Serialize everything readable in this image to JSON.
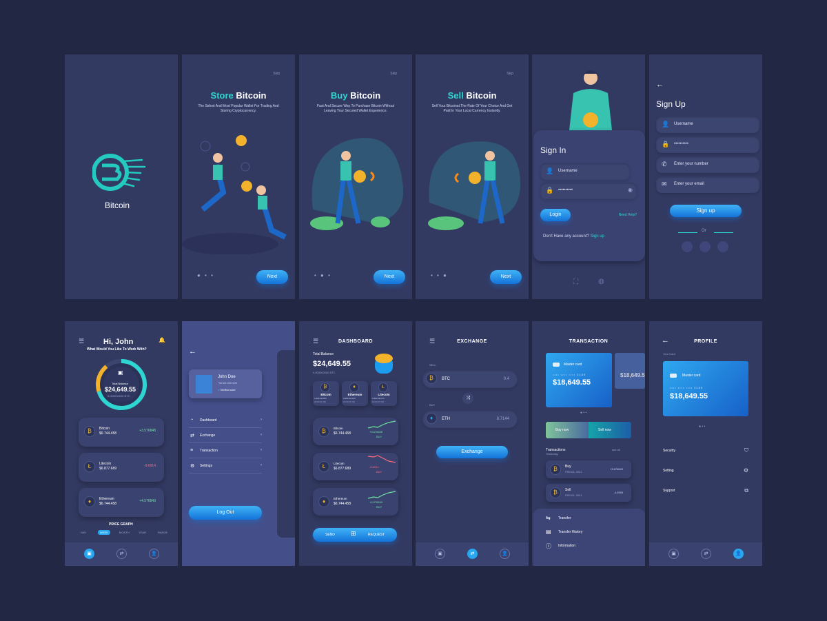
{
  "splash": {
    "title": "Bitcoin"
  },
  "onboarding": [
    {
      "skip": "Skip",
      "word": "Store",
      "coin": "Bitcoin",
      "desc": "The Safest And Most Popular Wallet For Trading And Storing Cryptocurrency.",
      "next": "Next"
    },
    {
      "skip": "Skip",
      "word": "Buy",
      "coin": "Bitcoin",
      "desc": "Fast And Secure Way To Purchase Bitcoin Without Leaving Your Secured Wallet Experience.",
      "next": "Next"
    },
    {
      "skip": "Skip",
      "word": "Sell",
      "coin": "Bitcoin",
      "desc": "Sell Your Bitcoinat The Rate Of Your Choice And Get Paid In Your Local Currency Instantly.",
      "next": "Next"
    }
  ],
  "signin": {
    "title": "Sign In",
    "username": "Username",
    "password": "••••••••••",
    "login": "Login",
    "help": "Need Help?",
    "no_account": "Don't Have any account?",
    "signup_link": "Sign up"
  },
  "signup": {
    "back": "←",
    "title": "Sign Up",
    "username": "Username",
    "password": "••••••••••",
    "phone": "Enter your number",
    "email": "Enter your email",
    "button": "Sign up",
    "or": "Or"
  },
  "home": {
    "greeting": "Hi, John",
    "question": "What Would You Like To Work With?",
    "total_label": "Total Balance",
    "total": "$24,649.55",
    "btc": "0.000000000 BTC",
    "coins": [
      {
        "name": "Bitcoin",
        "amount": "$6.744.458",
        "change": "+3.576848"
      },
      {
        "name": "Litecoin",
        "amount": "$6.877.689",
        "change": "-9.6914"
      },
      {
        "name": "Ethereum",
        "amount": "$6.744.458",
        "change": "+4.576849"
      }
    ],
    "graph_title": "PRICE GRAPH",
    "ranges": [
      "DAY",
      "WEEK",
      "MONTH",
      "YEAR",
      "RANGE"
    ]
  },
  "sidemenu": {
    "back": "←",
    "name": "John Doe",
    "phone": "+00 00 000 000",
    "verified": "Verified user",
    "items": [
      "Dashboard",
      "Exchange",
      "Transaction",
      "Settings"
    ],
    "logout": "Log Out"
  },
  "dashboard": {
    "title": "DASHBOARD",
    "total_label": "Total Balance",
    "total": "$24,649.55",
    "btc": "0.000000000 BTC",
    "minis": [
      {
        "name": "Bitcoin",
        "v1": "0.0000 000 BTC",
        "v2": "00,000.00 USD"
      },
      {
        "name": "Ethereum",
        "v1": "0.0000 000 ETH",
        "v2": "00,000.00 USD"
      },
      {
        "name": "Litecoin",
        "v1": "0.0000 000 LTC",
        "v2": "00,000.00 USD"
      }
    ],
    "rows": [
      {
        "name": "Bitcoin",
        "amount": "$6.744.458",
        "change": "+3.576848",
        "act": "BUY"
      },
      {
        "name": "Litecoin",
        "amount": "$6.877.689",
        "change": "-5.6914",
        "act": "BUY"
      },
      {
        "name": "Ethereum",
        "amount": "$6.744.458",
        "change": "+4.576849",
        "act": "BUY"
      }
    ],
    "send": "SEND",
    "request": "REQUEST"
  },
  "exchange": {
    "title": "EXCHANGE",
    "sell": "SELL",
    "buy": "BUY",
    "from": "BTC",
    "from_val": "0.4",
    "to": "ETH",
    "to_val": "8.7144",
    "button": "Exchange"
  },
  "transaction": {
    "title": "TRANSACTION",
    "card_name": "Master card",
    "card_number": "•••• •••• •••• 3185",
    "card_amount": "$18,649.55",
    "buy": "Buy now",
    "sell": "Sell now",
    "tx_title": "Transactions",
    "tx_sub": "Yesterday",
    "see_all": "see all",
    "rows": [
      {
        "type": "Buy",
        "date": "FEB 03, 2021",
        "amount": "+3.676849"
      },
      {
        "type": "Sell",
        "date": "FEB 03, 2021",
        "amount": "-4.3955"
      }
    ],
    "sheet": [
      "Transfer",
      "Transfer History",
      "Information"
    ]
  },
  "profile": {
    "title": "PROFILE",
    "card_label": "Your Card",
    "card_name": "Master card",
    "card_number": "•••• •••• •••• 3185",
    "card_amount": "$18,649.55",
    "items": [
      "Security",
      "Setting",
      "Support"
    ]
  }
}
